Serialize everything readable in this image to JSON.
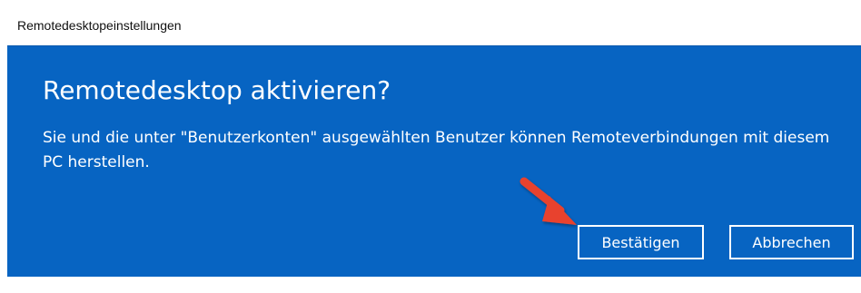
{
  "window": {
    "title": "Remotedesktopeinstellungen"
  },
  "dialog": {
    "heading": "Remotedesktop aktivieren?",
    "message": "Sie und die unter \"Benutzerkonten\" ausgewählten Benutzer können Remoteverbindungen mit diesem PC herstellen.",
    "background_color": "#0764c2",
    "confirm_label": "Bestätigen",
    "cancel_label": "Abbrechen"
  },
  "annotation": {
    "arrow_color": "#e8422f",
    "icon": "red-arrow-icon"
  }
}
